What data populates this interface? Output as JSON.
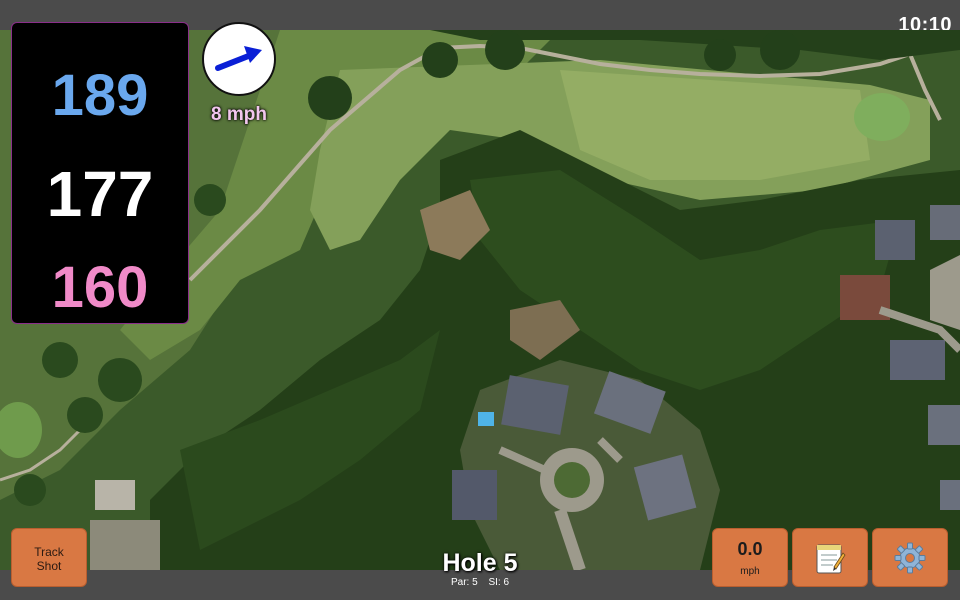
{
  "status_bar": {
    "time": "10:10"
  },
  "distances": {
    "back": "189",
    "center": "177",
    "front": "160"
  },
  "wind": {
    "speed_label": "8 mph",
    "direction_icon": "wind-arrow-icon"
  },
  "hole": {
    "title": "Hole 5",
    "par_label": "Par: 5",
    "si_label": "SI: 6"
  },
  "buttons": {
    "track_shot_line1": "Track",
    "track_shot_line2": "Shot",
    "speed_value": "0.0",
    "speed_unit": "mph",
    "notes_icon": "notepad-icon",
    "settings_icon": "gear-icon"
  },
  "colors": {
    "back": "#6aa8ee",
    "center": "#ffffff",
    "front": "#f08ac8",
    "button": "#d97843",
    "wind_arrow": "#0a1fd6"
  }
}
